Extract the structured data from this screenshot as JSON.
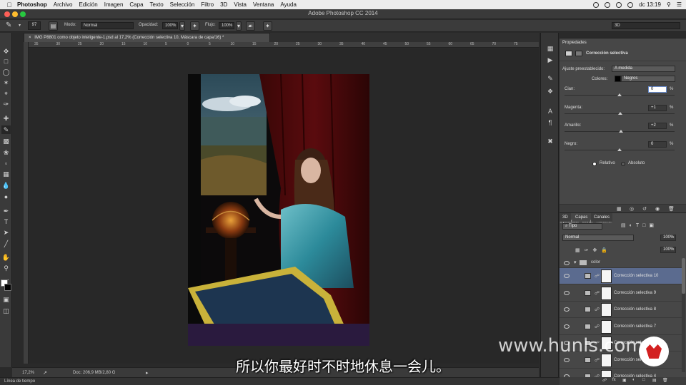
{
  "menubar": {
    "app": "Photoshop",
    "items": [
      "Archivo",
      "Edición",
      "Imagen",
      "Capa",
      "Texto",
      "Selección",
      "Filtro",
      "3D",
      "Vista",
      "Ventana",
      "Ayuda"
    ],
    "clock": "dc 13:19"
  },
  "window": {
    "title": "Adobe Photoshop CC 2014"
  },
  "options": {
    "brush_size": "97",
    "mode_label": "Modo:",
    "mode_value": "Normal",
    "opacity_label": "Opacidad:",
    "opacity_value": "100%",
    "flow_label": "Flujo:",
    "flow_value": "100%",
    "workspace": "3D"
  },
  "document": {
    "tab_title": "IMG P8801 como objeto inteligente-1.psd al 17,2% (Corrección selectiva 10, Máscara de capa/16) *"
  },
  "ruler": {
    "top_ticks": [
      "35",
      "30",
      "25",
      "20",
      "15",
      "10",
      "5",
      "0",
      "5",
      "10",
      "15",
      "20",
      "25",
      "30",
      "35",
      "40",
      "45",
      "50",
      "55",
      "60",
      "65",
      "70",
      "75"
    ]
  },
  "status": {
    "zoom": "17,2%",
    "doc": "Doc: 206,9 MB/2,80 G"
  },
  "timeline": "Línea de tiempo",
  "properties": {
    "tab": "Propiedades",
    "header": "Corrección selectiva",
    "preset_label": "Ajuste preestablecido:",
    "preset_value": "A medida",
    "colors_label": "Colores:",
    "colors_value": "Negros",
    "sliders": [
      {
        "label": "Cian:",
        "value": "0",
        "pos": 0.5
      },
      {
        "label": "Magenta:",
        "value": "+1",
        "pos": 0.505
      },
      {
        "label": "Amarillo:",
        "value": "+2",
        "pos": 0.51
      },
      {
        "label": "Negro:",
        "value": "0",
        "pos": 0.5
      }
    ],
    "percent": "%",
    "relative": "Relativo",
    "absolute": "Absoluto"
  },
  "layers": {
    "tabs": [
      "3D",
      "Capas",
      "Canales"
    ],
    "filter": "Tipo",
    "blend_mode": "Normal",
    "opacity_label": "Opacidad:",
    "opacity_value": "100%",
    "lock_label": "Bloq.:",
    "fill_label": "Relleno:",
    "fill_value": "100%",
    "group_name": "color",
    "rows": [
      {
        "name": "Corrección selectiva 10",
        "selected": true
      },
      {
        "name": "Corrección selectiva 9",
        "selected": false
      },
      {
        "name": "Corrección selectiva 8",
        "selected": false
      },
      {
        "name": "Corrección selectiva 7",
        "selected": false
      },
      {
        "name": "Corrección selectiva 6",
        "selected": false
      },
      {
        "name": "Corrección selectiva 5",
        "selected": false
      },
      {
        "name": "Corrección selectiva 4",
        "selected": false
      }
    ]
  },
  "overlay": {
    "subtitle": "所以你最好时不时地休息一会儿。",
    "watermark": "www.hunls.com"
  }
}
